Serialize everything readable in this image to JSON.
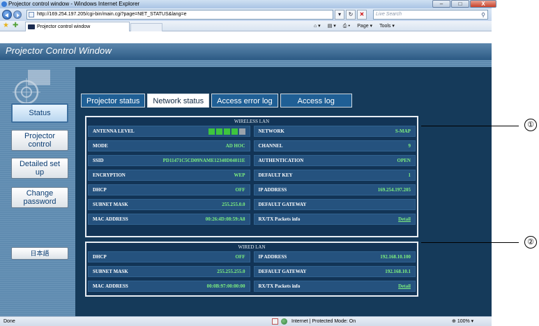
{
  "browser": {
    "window_title": "Projector control window - Windows Internet Explorer",
    "url": "http://169.254.197.205/cgi-bin/main.cgi?page=NET_STATUS&lang=e",
    "search_placeholder": "Live Search",
    "tab_title": "Projector control window",
    "commands": [
      "Page ▾",
      "Tools ▾"
    ],
    "status_text": "Done",
    "zone_text": "Internet | Protected Mode: On",
    "zoom": "100%"
  },
  "app": {
    "title": "Projector Control Window",
    "sidebar": [
      "Status",
      "Projector control",
      "Detailed set up",
      "Change password",
      "日本語"
    ],
    "tabs": [
      "Projector status",
      "Network status",
      "Access error log",
      "Access log"
    ],
    "active_tab": "Network status"
  },
  "wireless": {
    "title": "WIRELESS LAN",
    "antenna_label": "ANTENNA LEVEL",
    "antenna_bars_on": 4,
    "antenna_bars_total": 5,
    "rows": [
      {
        "label": "NETWORK",
        "value": "S-MAP"
      },
      {
        "label": "MODE",
        "value": "AD HOC"
      },
      {
        "label": "CHANNEL",
        "value": "9"
      },
      {
        "label": "SSID",
        "value": "PD11471C5CD09NAME12340D04011E"
      },
      {
        "label": "AUTHENTICATION",
        "value": "OPEN"
      },
      {
        "label": "ENCRYPTION",
        "value": "WEP"
      },
      {
        "label": "DEFAULT KEY",
        "value": "1"
      },
      {
        "label": "DHCP",
        "value": "OFF"
      },
      {
        "label": "IP ADDRESS",
        "value": "169.254.197.205"
      },
      {
        "label": "SUBNET MASK",
        "value": "255.255.0.0"
      },
      {
        "label": "DEFAULT GATEWAY",
        "value": ""
      },
      {
        "label": "MAC ADDRESS",
        "value": "00:26:4D:08:59:A8"
      },
      {
        "label": "RX/TX Packets info",
        "value": "Detail"
      }
    ]
  },
  "wired": {
    "title": "WIRED LAN",
    "rows": [
      {
        "label": "DHCP",
        "value": "OFF"
      },
      {
        "label": "IP ADDRESS",
        "value": "192.168.10.100"
      },
      {
        "label": "SUBNET MASK",
        "value": "255.255.255.0"
      },
      {
        "label": "DEFAULT GATEWAY",
        "value": "192.168.10.1"
      },
      {
        "label": "MAC ADDRESS",
        "value": "00:0B:97:00:00:00"
      },
      {
        "label": "RX/TX Packets info",
        "value": "Detail"
      }
    ]
  },
  "callouts": [
    "①",
    "②"
  ],
  "colors": {
    "panel_bg": "#153a5a",
    "cell_bg": "#25527e",
    "value_green": "#7ef07e",
    "antenna_on": "#3ec43e",
    "antenna_off": "#9aa3ab"
  }
}
